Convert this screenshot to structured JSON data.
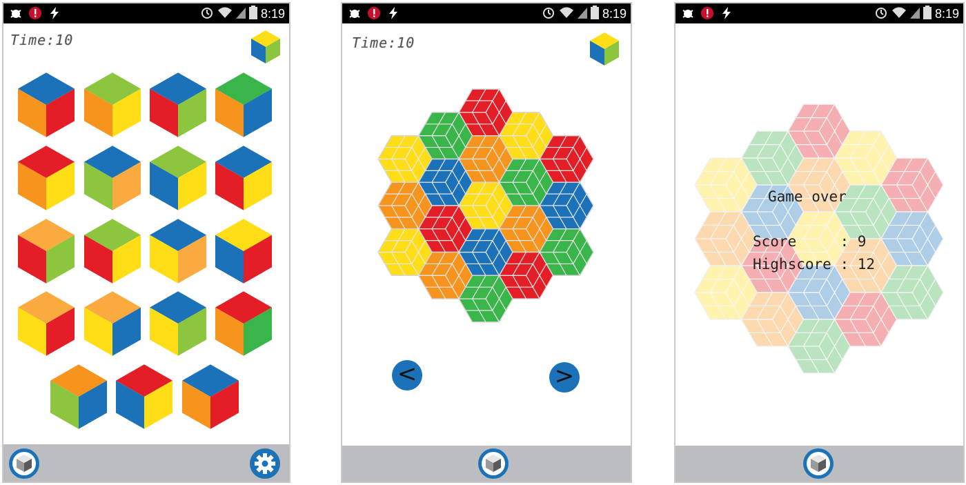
{
  "colors": {
    "red": "#e31e26",
    "blue": "#1b72b9",
    "yellow": "#ffde17",
    "orange": "#f7941d",
    "lightorange": "#fbaa3f",
    "green": "#39b54a",
    "lime": "#8cc63f",
    "bar": "#bcbdc0",
    "fab": "#1a73b8"
  },
  "status_bar": {
    "left_icons": [
      "bug-icon",
      "alert-icon",
      "usb-lightning-icon"
    ],
    "right_icons": [
      "alarm-icon",
      "wifi-icon",
      "signal-icon",
      "battery-icon"
    ],
    "time": "8:19"
  },
  "screen1": {
    "timer": "Time:10",
    "header_cube": {
      "top": "yellow",
      "left": "blue",
      "right": "lime"
    },
    "cubes": [
      [
        {
          "top": "blue",
          "left": "orange",
          "right": "red"
        },
        {
          "top": "lime",
          "left": "orange",
          "right": "yellow"
        },
        {
          "top": "blue",
          "left": "red",
          "right": "lime"
        },
        {
          "top": "green",
          "left": "orange",
          "right": "blue"
        }
      ],
      [
        {
          "top": "red",
          "left": "orange",
          "right": "yellow"
        },
        {
          "top": "blue",
          "left": "lime",
          "right": "lightorange"
        },
        {
          "top": "lime",
          "left": "blue",
          "right": "yellow"
        },
        {
          "top": "blue",
          "left": "red",
          "right": "yellow"
        }
      ],
      [
        {
          "top": "lightorange",
          "left": "red",
          "right": "lime"
        },
        {
          "top": "lime",
          "left": "red",
          "right": "yellow"
        },
        {
          "top": "blue",
          "left": "yellow",
          "right": "lightorange"
        },
        {
          "top": "yellow",
          "left": "blue",
          "right": "red"
        }
      ],
      [
        {
          "top": "lightorange",
          "left": "yellow",
          "right": "red"
        },
        {
          "top": "lightorange",
          "left": "yellow",
          "right": "blue"
        },
        {
          "top": "blue",
          "left": "yellow",
          "right": "lime"
        },
        {
          "top": "red",
          "left": "orange",
          "right": "green"
        }
      ],
      [
        {
          "top": "orange",
          "left": "lime",
          "right": "blue"
        },
        {
          "top": "red",
          "left": "blue",
          "right": "yellow"
        },
        {
          "top": "blue",
          "left": "orange",
          "right": "red"
        }
      ]
    ]
  },
  "screen2": {
    "timer": "Time:10",
    "header_cube": {
      "top": "yellow",
      "left": "blue",
      "right": "lime"
    },
    "board": [
      {
        "q": 0,
        "r": -2,
        "c": "red"
      },
      {
        "q": -1,
        "r": -1,
        "c": "green"
      },
      {
        "q": 1,
        "r": -2,
        "c": "yellow"
      },
      {
        "q": -2,
        "r": 0,
        "c": "yellow"
      },
      {
        "q": 0,
        "r": -1,
        "c": "orange"
      },
      {
        "q": 2,
        "r": -2,
        "c": "red"
      },
      {
        "q": -1,
        "r": 0,
        "c": "blue"
      },
      {
        "q": 1,
        "r": -1,
        "c": "green"
      },
      {
        "q": -2,
        "r": 1,
        "c": "orange"
      },
      {
        "q": 0,
        "r": 0,
        "c": "yellow"
      },
      {
        "q": 2,
        "r": -1,
        "c": "blue"
      },
      {
        "q": -1,
        "r": 1,
        "c": "red"
      },
      {
        "q": 1,
        "r": 0,
        "c": "orange"
      },
      {
        "q": -2,
        "r": 2,
        "c": "yellow"
      },
      {
        "q": 0,
        "r": 1,
        "c": "blue"
      },
      {
        "q": 2,
        "r": 0,
        "c": "green"
      },
      {
        "q": -1,
        "r": 2,
        "c": "orange"
      },
      {
        "q": 1,
        "r": 1,
        "c": "red"
      },
      {
        "q": 0,
        "r": 2,
        "c": "green"
      }
    ],
    "prev_label": "<",
    "next_label": ">"
  },
  "screen3": {
    "board": [
      {
        "q": 0,
        "r": -2,
        "c": "red"
      },
      {
        "q": -1,
        "r": -1,
        "c": "green"
      },
      {
        "q": 1,
        "r": -2,
        "c": "yellow"
      },
      {
        "q": -2,
        "r": 0,
        "c": "yellow"
      },
      {
        "q": 0,
        "r": -1,
        "c": "orange"
      },
      {
        "q": 2,
        "r": -2,
        "c": "red"
      },
      {
        "q": -1,
        "r": 0,
        "c": "blue"
      },
      {
        "q": 1,
        "r": -1,
        "c": "green"
      },
      {
        "q": -2,
        "r": 1,
        "c": "orange"
      },
      {
        "q": 0,
        "r": 0,
        "c": "yellow"
      },
      {
        "q": 2,
        "r": -1,
        "c": "blue"
      },
      {
        "q": -1,
        "r": 1,
        "c": "red"
      },
      {
        "q": 1,
        "r": 0,
        "c": "orange"
      },
      {
        "q": -2,
        "r": 2,
        "c": "yellow"
      },
      {
        "q": 0,
        "r": 1,
        "c": "blue"
      },
      {
        "q": 2,
        "r": 0,
        "c": "green"
      },
      {
        "q": -1,
        "r": 2,
        "c": "orange"
      },
      {
        "q": 1,
        "r": 1,
        "c": "red"
      },
      {
        "q": 0,
        "r": 2,
        "c": "green"
      }
    ],
    "game_over": "Game over",
    "score_label": "Score",
    "score_sep": ": ",
    "score_value": "9",
    "highscore_label": "Highscore",
    "highscore_value": "12"
  }
}
